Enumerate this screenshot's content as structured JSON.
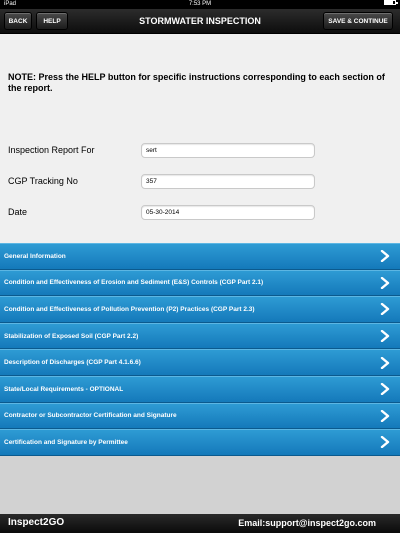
{
  "statusbar": {
    "carrier": "iPad",
    "time": "7:53 PM",
    "battery_level": 0.75
  },
  "nav": {
    "back_label": "BACK",
    "help_label": "HELP",
    "title": "STORMWATER INSPECTION",
    "save_label": "SAVE & CONTINUE"
  },
  "note": "NOTE: Press the HELP button for specific instructions corresponding to each section of the report.",
  "form": {
    "report_for": {
      "label": "Inspection Report For",
      "value": "sert"
    },
    "cgp_tracking": {
      "label": "CGP Tracking No",
      "value": "357"
    },
    "date": {
      "label": "Date",
      "value": "05-30-2014"
    }
  },
  "sections": [
    "General Information",
    "Condition and Effectiveness of Erosion and Sediment (E&S) Controls (CGP Part 2.1)",
    "Condition and Effectiveness of Pollution Prevention (P2) Practices (CGP Part 2.3)",
    "Stabilization of Exposed Soil (CGP Part 2.2)",
    "Description of Discharges (CGP Part 4.1.6.6)",
    "State/Local Requirements - OPTIONAL",
    "Contractor or Subcontractor Certification and Signature",
    "Certification and Signature by Permittee"
  ],
  "footer": {
    "brand": "Inspect2GO",
    "email": "Email:support@inspect2go.com"
  },
  "colors": {
    "section_blue": "#1f8cc9",
    "nav_black": "#111111"
  },
  "icons": {
    "section_chevron": "chevron-right-icon"
  }
}
